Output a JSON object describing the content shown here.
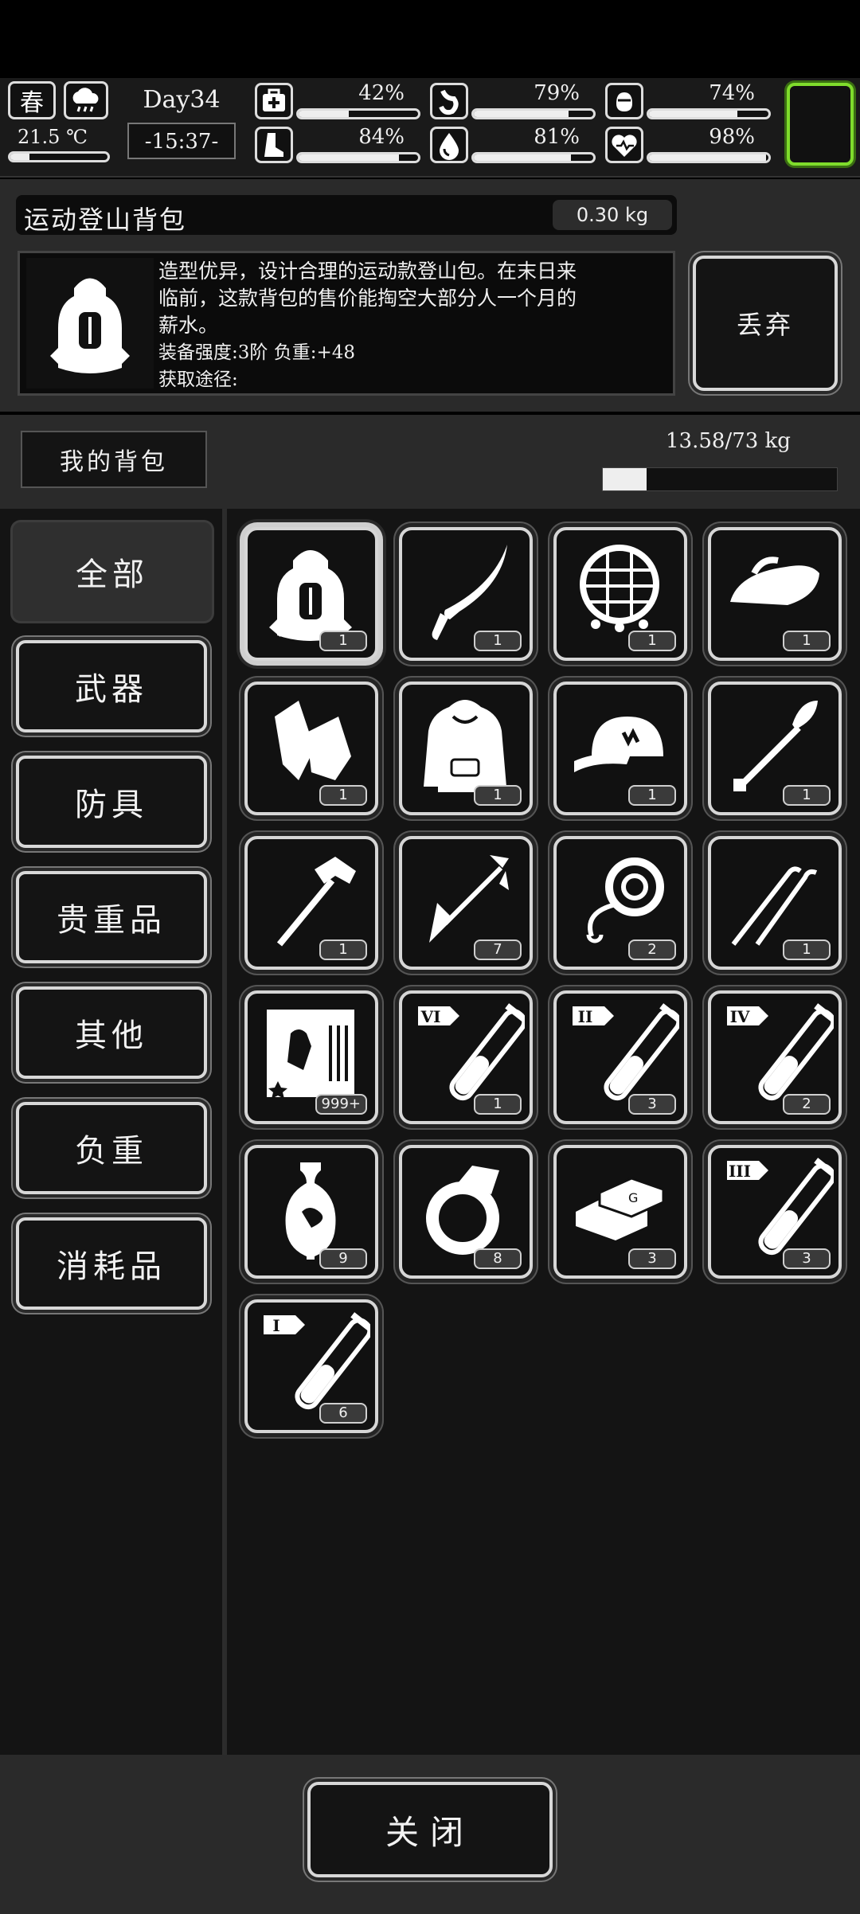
{
  "hud": {
    "season": "春",
    "temperature": "21.5 ℃",
    "day": "Day34",
    "time": "-15:37-",
    "stats": [
      {
        "icon": "medkit-icon",
        "pct_label": "42%",
        "value": 0.42
      },
      {
        "icon": "stomach-icon",
        "pct_label": "79%",
        "value": 0.79
      },
      {
        "icon": "bladder-icon",
        "pct_label": "74%",
        "value": 0.74
      },
      {
        "icon": "foot-icon",
        "pct_label": "84%",
        "value": 0.84
      },
      {
        "icon": "water-drop-icon",
        "pct_label": "81%",
        "value": 0.81
      },
      {
        "icon": "heart-icon",
        "pct_label": "98%",
        "value": 0.98
      }
    ]
  },
  "item": {
    "name": "运动登山背包",
    "weight": "0.30 kg",
    "desc_line1": "造型优异，设计合理的运动款登山包。在末日来",
    "desc_line2": "临前，这款背包的售价能掏空大部分人一个月的",
    "desc_line3": "薪水。",
    "desc_line4": "装备强度:3阶  负重:+48",
    "desc_line5": "获取途径:",
    "discard_label": "丢弃"
  },
  "bag": {
    "title": "我的背包",
    "capacity": "13.58/73 kg",
    "fill": 0.186
  },
  "tabs": [
    "全部",
    "武器",
    "防具",
    "贵重品",
    "其他",
    "负重",
    "消耗品"
  ],
  "items": [
    {
      "icon": "backpack-icon",
      "count": "1"
    },
    {
      "icon": "machete-icon",
      "count": "1"
    },
    {
      "icon": "net-icon",
      "count": "1"
    },
    {
      "icon": "iron-icon",
      "count": "1"
    },
    {
      "icon": "gloves-icon",
      "count": "1"
    },
    {
      "icon": "hoodie-icon",
      "count": "1"
    },
    {
      "icon": "cap-icon",
      "count": "1"
    },
    {
      "icon": "shovel-icon",
      "count": "1"
    },
    {
      "icon": "hammer-icon",
      "count": "1"
    },
    {
      "icon": "arrow-icon",
      "count": "7"
    },
    {
      "icon": "rope-icon",
      "count": "2"
    },
    {
      "icon": "lockpick-icon",
      "count": "1"
    },
    {
      "icon": "poster-icon",
      "count": "999+"
    },
    {
      "icon": "test-tube-vi-icon",
      "count": "1",
      "tag": "VI"
    },
    {
      "icon": "test-tube-ii-icon",
      "count": "3",
      "tag": "II"
    },
    {
      "icon": "test-tube-iv-icon",
      "count": "2",
      "tag": "IV"
    },
    {
      "icon": "vase-icon",
      "count": "9"
    },
    {
      "icon": "ring-icon",
      "count": "8"
    },
    {
      "icon": "gold-bars-icon",
      "count": "3"
    },
    {
      "icon": "test-tube-iii-icon",
      "count": "3",
      "tag": "III"
    },
    {
      "icon": "test-tube-i-icon",
      "count": "6",
      "tag": "I"
    }
  ],
  "close_label": "关闭"
}
